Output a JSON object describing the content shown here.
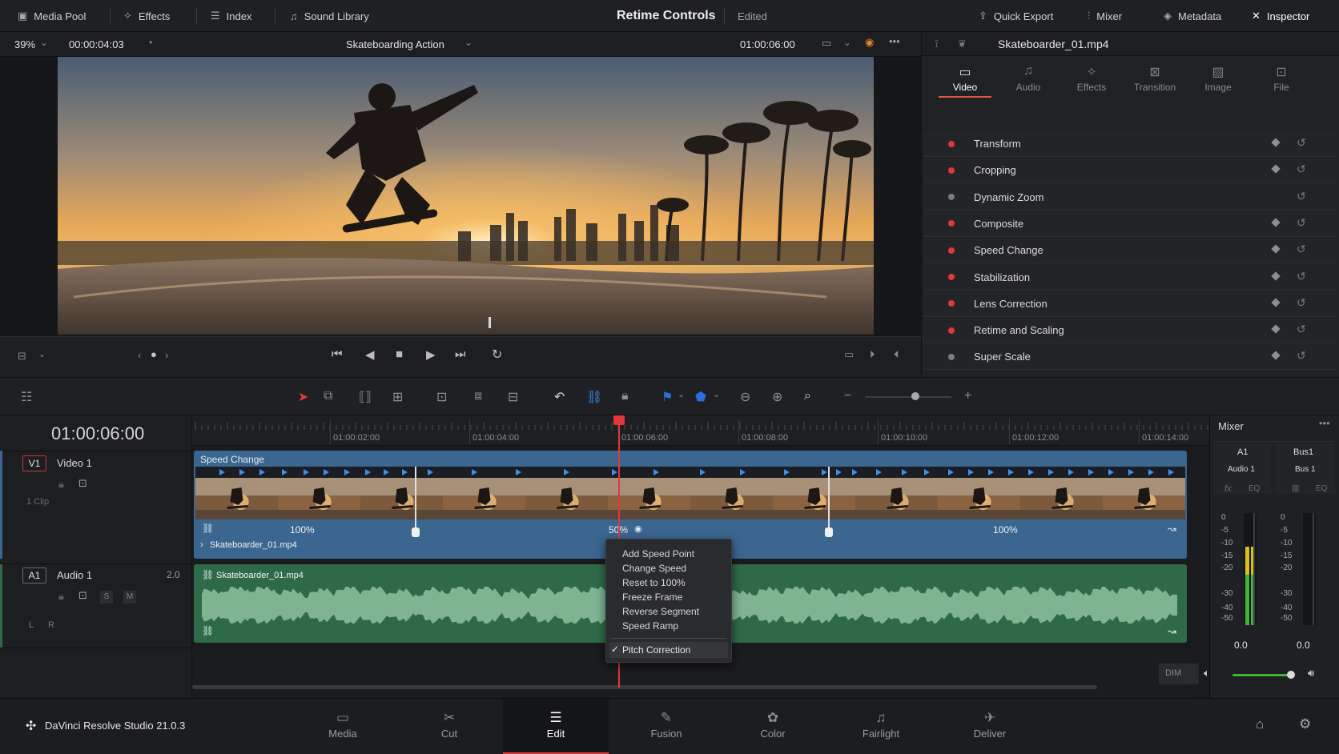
{
  "topbar": {
    "media_pool": "Media Pool",
    "effects": "Effects",
    "index": "Index",
    "sound_library": "Sound Library",
    "title": "Retime Controls",
    "status": "Edited",
    "quick_export": "Quick Export",
    "mixer": "Mixer",
    "metadata": "Metadata",
    "inspector": "Inspector"
  },
  "viewer": {
    "zoom": "39%",
    "source_tc": "00:00:04:03",
    "clip_name": "Skateboarding Action",
    "record_tc": "01:00:06:00"
  },
  "inspector": {
    "clip_file": "Skateboarder_01.mp4",
    "tabs": [
      "Video",
      "Audio",
      "Effects",
      "Transition",
      "Image",
      "File"
    ],
    "rows": [
      {
        "label": "Transform",
        "on": true
      },
      {
        "label": "Cropping",
        "on": true
      },
      {
        "label": "Dynamic Zoom",
        "on": false
      },
      {
        "label": "Composite",
        "on": true
      },
      {
        "label": "Speed Change",
        "on": true
      },
      {
        "label": "Stabilization",
        "on": true
      },
      {
        "label": "Lens Correction",
        "on": true
      },
      {
        "label": "Retime and Scaling",
        "on": true
      },
      {
        "label": "Super Scale",
        "on": false
      }
    ]
  },
  "timeline": {
    "timecode": "01:00:06:00",
    "ruler": [
      "01:00:02:00",
      "01:00:04:00",
      "01:00:06:00",
      "01:00:08:00",
      "01:00:10:00",
      "01:00:12:00",
      "01:00:14:00"
    ],
    "v1": {
      "id": "V1",
      "name": "Video 1",
      "count": "1 Clip"
    },
    "a1": {
      "id": "A1",
      "name": "Audio 1",
      "level": "2.0",
      "s": "S",
      "m": "M",
      "l": "L",
      "r": "R"
    },
    "speed_label": "Speed Change",
    "speeds": [
      "100%",
      "50%",
      "100%"
    ],
    "video_clip": "Skateboarder_01.mp4",
    "audio_clip": "Skateboarder_01.mp4"
  },
  "context_menu": {
    "items": [
      "Add Speed Point",
      "Change Speed",
      "Reset to 100%",
      "Freeze Frame",
      "Reverse Segment",
      "Speed Ramp"
    ],
    "checked_item": "Pitch Correction"
  },
  "mixer": {
    "title": "Mixer",
    "ch1": "A1",
    "ch1_name": "Audio 1",
    "ch2": "Bus1",
    "ch2_name": "Bus 1",
    "fx": "fx",
    "eq": "EQ",
    "scale": [
      "0",
      "-5",
      "-10",
      "-15",
      "-20",
      "-30",
      "-40",
      "-50"
    ],
    "val1": "0.0",
    "val2": "0.0",
    "dim": "DIM",
    "level_fraction": 0.7
  },
  "bottom": {
    "app": "DaVinci Resolve Studio 21.0.3",
    "pages": [
      "Media",
      "Cut",
      "Edit",
      "Fusion",
      "Color",
      "Fairlight",
      "Deliver"
    ],
    "active": "Edit"
  },
  "colors": {
    "accent_red": "#e2383b",
    "video_clip": "#3a6690",
    "audio_clip": "#2f6a48",
    "active_tab": "#e05a3a"
  }
}
